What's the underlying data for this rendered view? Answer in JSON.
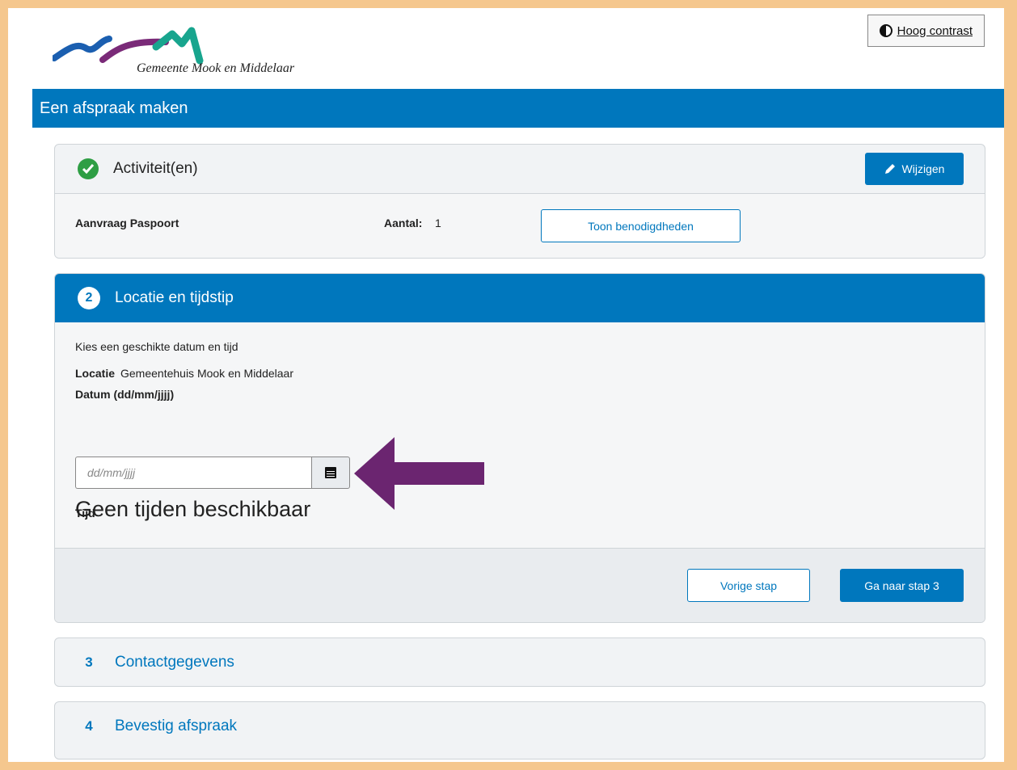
{
  "header": {
    "municipality_name": "Gemeente Mook en Middelaar",
    "contrast_button": "Hoog contrast",
    "page_title": "Een afspraak maken"
  },
  "colors": {
    "primary_blue": "#0077bd",
    "success_green": "#2e9e44",
    "annotation_purple": "#6b2570",
    "frame_border": "#f5c78e",
    "logo_teal": "#18a58e"
  },
  "step1": {
    "title": "Activiteit(en)",
    "edit_button": "Wijzigen",
    "activity_name": "Aanvraag Paspoort",
    "count_label": "Aantal:",
    "count_value": "1",
    "show_requirements_button": "Toon benodigdheden"
  },
  "step2": {
    "number": "2",
    "title": "Locatie en tijdstip",
    "instruction": "Kies een geschikte datum en tijd",
    "location_label": "Locatie",
    "location_value": "Gemeentehuis Mook en Middelaar",
    "date_label": "Datum (dd/mm/jjjj)",
    "date_placeholder": "dd/mm/jjjj",
    "time_label": "Tijd",
    "no_times_message": "Geen tijden beschikbaar",
    "prev_button": "Vorige stap",
    "next_button": "Ga naar stap 3"
  },
  "step3": {
    "number": "3",
    "title": "Contactgegevens"
  },
  "step4": {
    "number": "4",
    "title": "Bevestig afspraak"
  }
}
